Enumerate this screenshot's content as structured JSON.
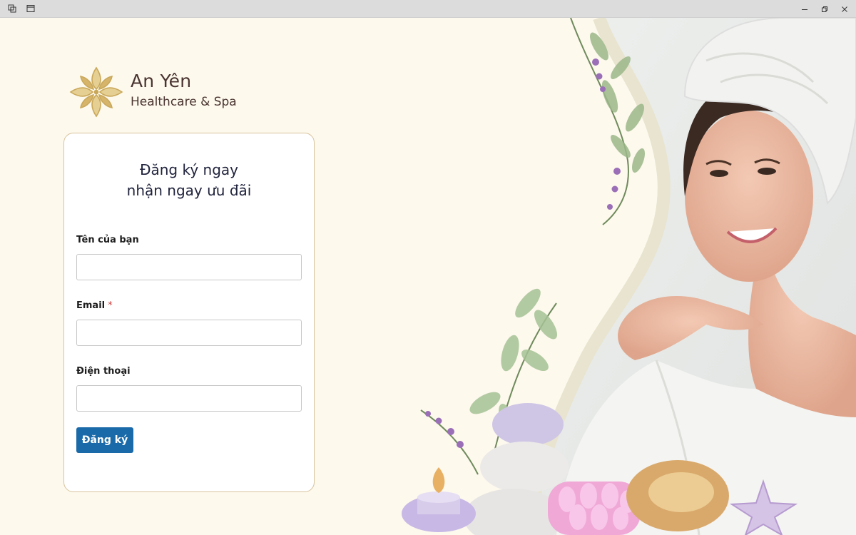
{
  "brand": {
    "name": "An Yên",
    "tagline": "Healthcare & Spa"
  },
  "form": {
    "title_line1": "Đăng ký ngay",
    "title_line2": "nhận ngay ưu đãi",
    "fields": [
      {
        "label": "Tên của bạn",
        "required": false,
        "value": "",
        "placeholder": ""
      },
      {
        "label": "Email",
        "required": true,
        "required_mark": "*",
        "value": "",
        "placeholder": ""
      },
      {
        "label": "Điện thoại",
        "required": false,
        "value": "",
        "placeholder": ""
      }
    ],
    "submit_label": "Đăng ký"
  },
  "window": {
    "controls": [
      "minimize-icon",
      "restore-icon",
      "close-icon"
    ]
  },
  "colors": {
    "background": "#fdf9ed",
    "brand_text": "#4a3431",
    "gold": "#c9a85a",
    "card_border": "#d7c39c",
    "primary_button": "#1a69a8",
    "required_mark": "#d43c3c"
  }
}
